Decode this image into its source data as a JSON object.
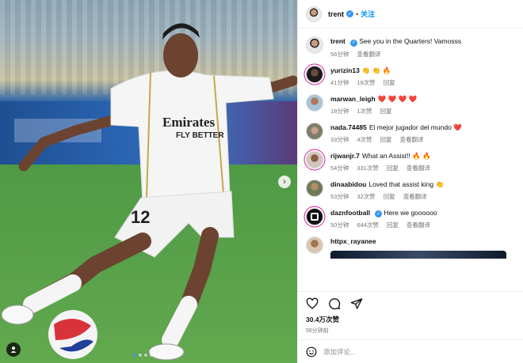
{
  "post": {
    "author": "trent",
    "follow_label": "关注",
    "sep": "•",
    "caption": "See you in the Quarters! Vamosss",
    "caption_time": "56分钟",
    "caption_translate": "查看翻译"
  },
  "photo": {
    "jersey_sponsor_1": "Emirates",
    "jersey_sponsor_2": "FLY BETTER",
    "jersey_number": "12",
    "carousel_next_icon": "chevron-right-icon",
    "tag_icon": "person-tag-icon"
  },
  "comments": [
    {
      "user": "yurizin13",
      "text": "👏 👏 🔥",
      "time": "41分钟",
      "likes": "19次赞",
      "reply": "回复",
      "translate": ""
    },
    {
      "user": "marwan_leigh",
      "text": "❤️ ❤️ ❤️ ❤️",
      "time": "18分钟",
      "likes": "1次赞",
      "reply": "回复",
      "translate": ""
    },
    {
      "user": "nada.74485",
      "text": "El mejor jugador del mundo ❤️",
      "time": "33分钟",
      "likes": "4次赞",
      "reply": "回复",
      "translate": "查看翻译"
    },
    {
      "user": "rijwanjr.7",
      "text": "What an Assist!! 🔥 🔥",
      "time": "54分钟",
      "likes": "331次赞",
      "reply": "回复",
      "translate": "查看翻译"
    },
    {
      "user": "dinaabidou",
      "text": "Loved that assist king 👏",
      "time": "53分钟",
      "likes": "32次赞",
      "reply": "回复",
      "translate": "查看翻译"
    },
    {
      "user": "daznfootball",
      "text": "Here we goooooo",
      "time": "50分钟",
      "likes": "644次赞",
      "reply": "回复",
      "translate": "查看翻译"
    },
    {
      "user": "httpx_rayanee",
      "text": "",
      "time": "",
      "likes": "",
      "reply": "",
      "translate": ""
    }
  ],
  "footer": {
    "likes_count": "30.4万次赞",
    "post_time": "56分钟前",
    "comment_placeholder": "添加评论..."
  },
  "colors": {
    "accent": "#0095f6",
    "verified": "#3897f0",
    "heart": "#ed4956"
  }
}
